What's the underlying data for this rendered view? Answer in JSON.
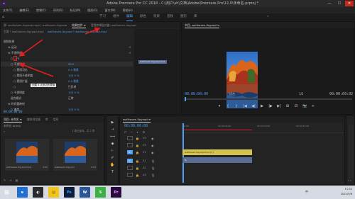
{
  "window": {
    "app_icon_text": "Pr",
    "title": "Adobe Premiere Pro CC 2018 - C:\\用户\\sh\\文档\\Adobe\\Premiere Pro\\12.0\\未命名.prproj *",
    "minimize": "—",
    "maximize": "☐",
    "close": "✕"
  },
  "menu": [
    "文件(F)",
    "编辑(E)",
    "剪辑(C)",
    "序列(S)",
    "标记(M)",
    "图形(G)",
    "窗口(W)",
    "帮助(H)"
  ],
  "workspaces": {
    "home": "⌂",
    "tabs": [
      "学习",
      "组件",
      "编辑",
      "颜色",
      "效果",
      "音频",
      "图形",
      "库"
    ],
    "active": "编辑",
    "more": "»"
  },
  "effect_controls": {
    "tabs": [
      "源: wallhaven-0qyxqd.mp4 | wallhaven-0qyxqd",
      "效果控件 ≡",
      "音频剪辑混合器: wallhaven-0qyxqd"
    ],
    "header_master": "主要 * wallhaven-0qyxqd.mp4",
    "header_seq": "wallhaven-0qyxqd * wallhaven-0qyxqd.mp4",
    "section_video": "视频效果",
    "rows": [
      {
        "label": "fx  运动",
        "value": ""
      },
      {
        "label": "fx  不透明度",
        "value": ""
      },
      {
        "label": "○ □ ✎",
        "value": ""
      },
      {
        "label": "○ 不透明度",
        "value": ""
      },
      {
        "label": "混合模式",
        "value": "正常"
      },
      {
        "label": "fx  时间重映射",
        "value": ""
      },
      {
        "label": "○ 速度",
        "value": "100.0 %"
      }
    ],
    "tooltip": "创建 4 点多边形蒙版",
    "clip_label": "wallhaven-0qyxqd.mp4",
    "extra_values": [
      "50.0",
      "100.0 %",
      "0.0 像素",
      "100.0 %",
      "已反转"
    ],
    "timecode": "00:00:00:00"
  },
  "program_monitor": {
    "tab": "节目: wallhaven-0qyxqd ≡",
    "timecode_left": "00:00:00:00",
    "fit": "适合",
    "ratio": "1/2",
    "timecode_right": "00:00:09:02",
    "transport": [
      "▾",
      "{",
      "}",
      "|◀",
      "◀|",
      "▶",
      "|▶",
      "▶|",
      "⊞",
      "⊟",
      "📷",
      "+"
    ]
  },
  "project": {
    "tabs": [
      "项目: 未命名 ≡",
      "媒体浏览器",
      "库",
      "信息",
      "效果",
      "标记",
      "历史记录"
    ],
    "file": "未命名.prproj",
    "count": "1 项已选择，共 2 项",
    "items": [
      {
        "name": "wallhaven-0qyxqd.mp4",
        "duration": "9:02"
      },
      {
        "name": "wallhaven-0qyxqd",
        "duration": "9:02"
      }
    ]
  },
  "timeline": {
    "tab": "wallhaven-0qyxqd ≡",
    "timecode": "00:00:00:00",
    "ruler": [
      "00:00",
      "00:00:05:00",
      "00:00:10:00",
      "00:00:15:00"
    ],
    "tracks": [
      {
        "target": "",
        "id": "V3"
      },
      {
        "target": "",
        "id": "V2"
      },
      {
        "target": "V1",
        "id": "V1"
      },
      {
        "target": "A1",
        "id": "A1"
      },
      {
        "target": "",
        "id": "A2"
      },
      {
        "target": "",
        "id": "A3"
      }
    ],
    "video_clip": "wallhaven-0qyxqd.mp4 [V]",
    "audio_clip": "fx",
    "meter_label": "S S"
  },
  "tools": [
    "▶",
    "⇢",
    "⟺",
    "◆",
    "⊢",
    "✐",
    "✋",
    "T"
  ],
  "taskbar": {
    "items": [
      {
        "label": "⊞",
        "bg": "#0078d7",
        "color": "#ffffff"
      },
      {
        "label": "e",
        "bg": "#1e6fd0",
        "color": "#ffffff"
      },
      {
        "label": "◐",
        "bg": "#2a2a2a",
        "color": "#ffffff"
      },
      {
        "label": "▤",
        "bg": "#f0c419",
        "color": "#7a4a00"
      },
      {
        "label": "Ps",
        "bg": "#0b1d3a",
        "color": "#31a8ff"
      },
      {
        "label": "W",
        "bg": "#2b579a",
        "color": "#ffffff"
      },
      {
        "label": "S",
        "bg": "#3cb043",
        "color": "#ffffff"
      },
      {
        "label": "Pr",
        "bg": "#2a0a3d",
        "color": "#e09cff"
      }
    ],
    "time": "11:52",
    "date": "2021/5/6",
    "lang": "中"
  },
  "colors": {
    "accent": "#4f9ef8",
    "annotation_arrow": "#e02020",
    "clip_video": "#d4c24f",
    "clip_audio": "#5b6d96"
  }
}
